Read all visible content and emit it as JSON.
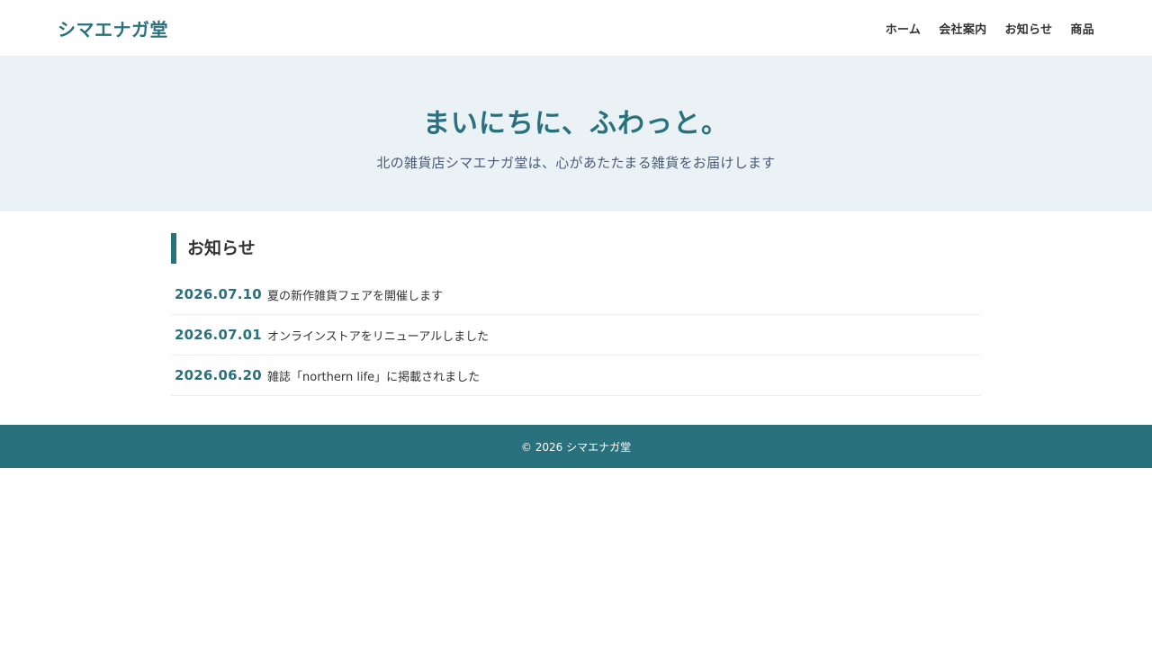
{
  "header": {
    "logo": "シマエナガ堂",
    "nav": [
      {
        "label": "ホーム"
      },
      {
        "label": "会社案内"
      },
      {
        "label": "お知らせ"
      },
      {
        "label": "商品"
      }
    ]
  },
  "hero": {
    "title": "まいにちに、ふわっと。",
    "subtitle": "北の雑貨店シマエナガ堂は、心があたたまる雑貨をお届けします"
  },
  "news": {
    "heading": "お知らせ",
    "items": [
      {
        "date": "2026.07.10",
        "title": "夏の新作雑貨フェアを開催します"
      },
      {
        "date": "2026.07.01",
        "title": "オンラインストアをリニューアルしました"
      },
      {
        "date": "2026.06.20",
        "title": "雑誌「northern life」に掲載されました"
      }
    ]
  },
  "footer": {
    "copyright": "© 2026 シマエナガ堂"
  },
  "colors": {
    "accent": "#2a717e",
    "hero_bg": "#eaf2f5",
    "subtitle": "#4a5a78",
    "text": "#333333"
  }
}
